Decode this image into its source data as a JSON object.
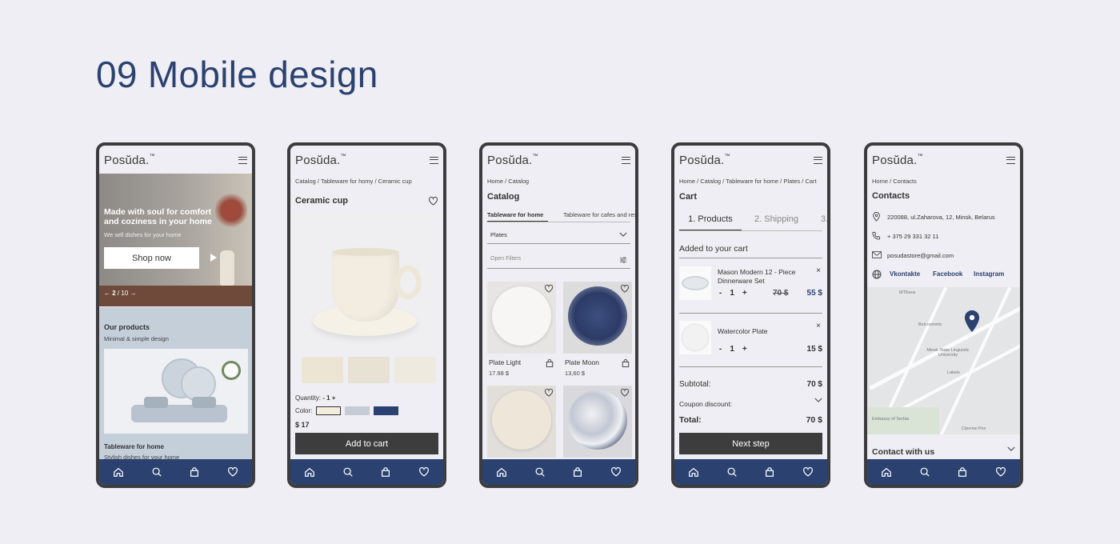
{
  "title": "09 Mobile design",
  "brand": "Posŭda.",
  "tm": "™",
  "colors": {
    "accent": "#2b4270",
    "dark": "#3d3d3d",
    "bg": "#efeef4"
  },
  "nav_icons": [
    "home-icon",
    "search-icon",
    "bag-icon",
    "heart-icon"
  ],
  "screen1": {
    "hero_title": "Made with soul for comfort and coziness in your home",
    "hero_sub": "We sell dishes for your home",
    "shop_btn": "Shop now",
    "slide_current": "2",
    "slide_total": "/ 10",
    "section_title": "Our products",
    "section_sub": "Minimal & simple design",
    "card_title": "Tableware for home",
    "card_sub": "Stylish dishes for your home"
  },
  "screen2": {
    "breadcrumb": "Catalog / Tableware for homy / Ceramic cup",
    "product": "Ceramic cup",
    "quantity_label": "Quantity:",
    "quantity_value": "- 1 +",
    "color_label": "Color:",
    "price": "$ 17",
    "add_btn": "Add to cart",
    "swatches": [
      "#f2eddc",
      "#c6ccd6",
      "#2b4270"
    ]
  },
  "screen3": {
    "breadcrumb": "Home / Catalog",
    "heading": "Catalog",
    "tabs": [
      "Tableware for home",
      "Tableware for cafes and res"
    ],
    "dropdown": "Plates",
    "filters": "Open Filters",
    "items": [
      {
        "name": "Plate Light",
        "price": "17.98 $"
      },
      {
        "name": "Plate Moon",
        "price": "13,60 $"
      }
    ]
  },
  "screen4": {
    "breadcrumb": "Home / Catalog / Tableware for home / Plates / Cart",
    "heading": "Cart",
    "steps": [
      "1. Products",
      "2. Shipping",
      "3."
    ],
    "added": "Added to your cart",
    "items": [
      {
        "name": "Mason Modern 12 - Piece Dinnerware Set",
        "qty": "1",
        "old": "70 $",
        "price": "55 $"
      },
      {
        "name": "Watercolor Plate",
        "qty": "1",
        "price": "15 $"
      }
    ],
    "minus": "-",
    "plus": "+",
    "remove": "×",
    "subtotal_label": "Subtotal:",
    "subtotal": "70 $",
    "coupon": "Coupon discount:",
    "total_label": "Total:",
    "total": "70 $",
    "next_btn": "Next step"
  },
  "screen5": {
    "breadcrumb": "Home / Contacts",
    "heading": "Contacts",
    "address": "220088, ul.Zaharova, 12, Minsk, Belarus",
    "phone": "+ 375 29 331 32 11",
    "email": "posudastore@gmail.com",
    "socials": [
      "Vkontakte",
      "Facebook",
      "Instagram"
    ],
    "map_labels": [
      "МТБанк",
      "Belcosmetic",
      "Minsk State Linguistic University",
      "Lakeis",
      "Embassy of Serbia",
      "Сірочок Роз"
    ],
    "contact_with_us": "Contact with us"
  }
}
